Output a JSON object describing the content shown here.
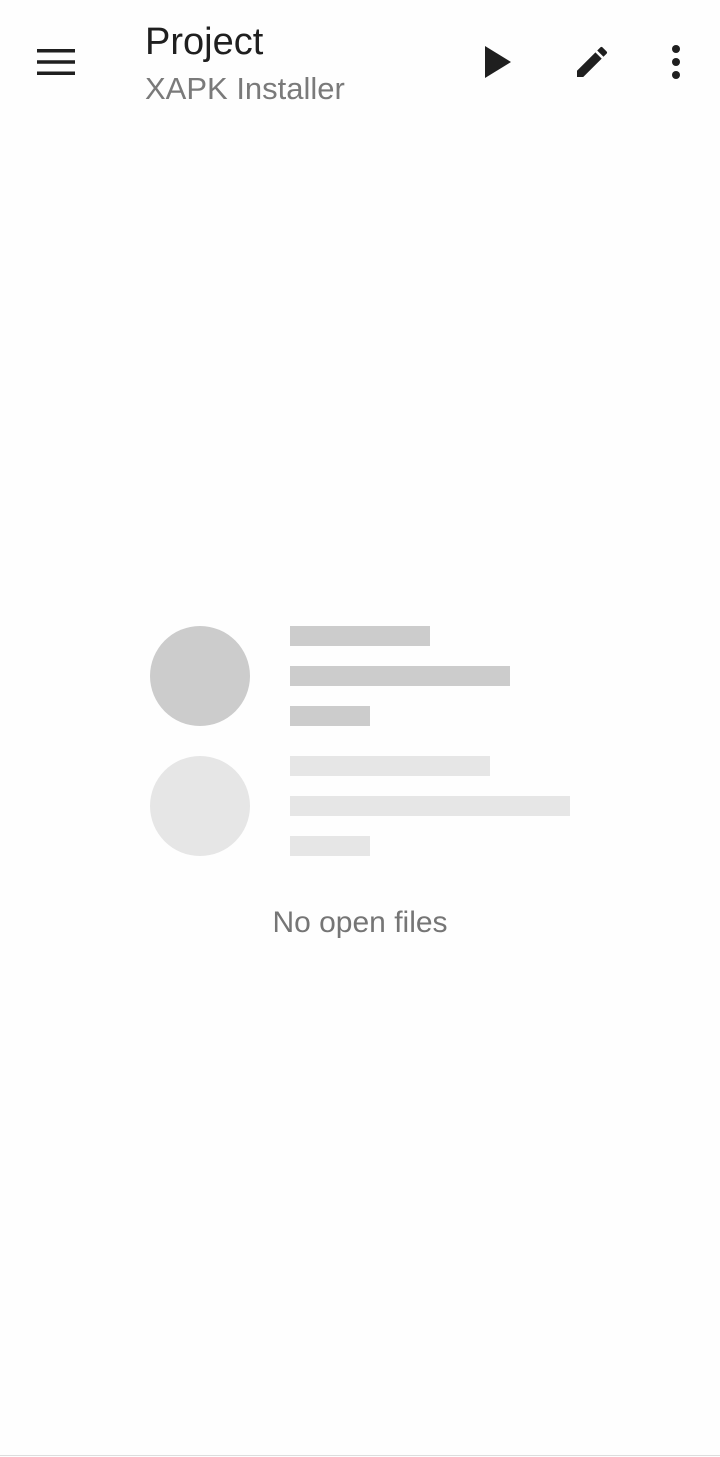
{
  "toolbar": {
    "title": "Project",
    "subtitle": "XAPK Installer",
    "icons": {
      "navigation": "menu-icon",
      "run": "play-icon",
      "edit": "pencil-icon",
      "more": "more-vert-icon"
    }
  },
  "empty_state": {
    "message": "No open files"
  },
  "colors": {
    "title": "#1f1f1f",
    "subtitle": "#7a7a7a",
    "placeholder_dark": "#cccccc",
    "placeholder_light": "#e6e6e6",
    "message": "#757575"
  }
}
